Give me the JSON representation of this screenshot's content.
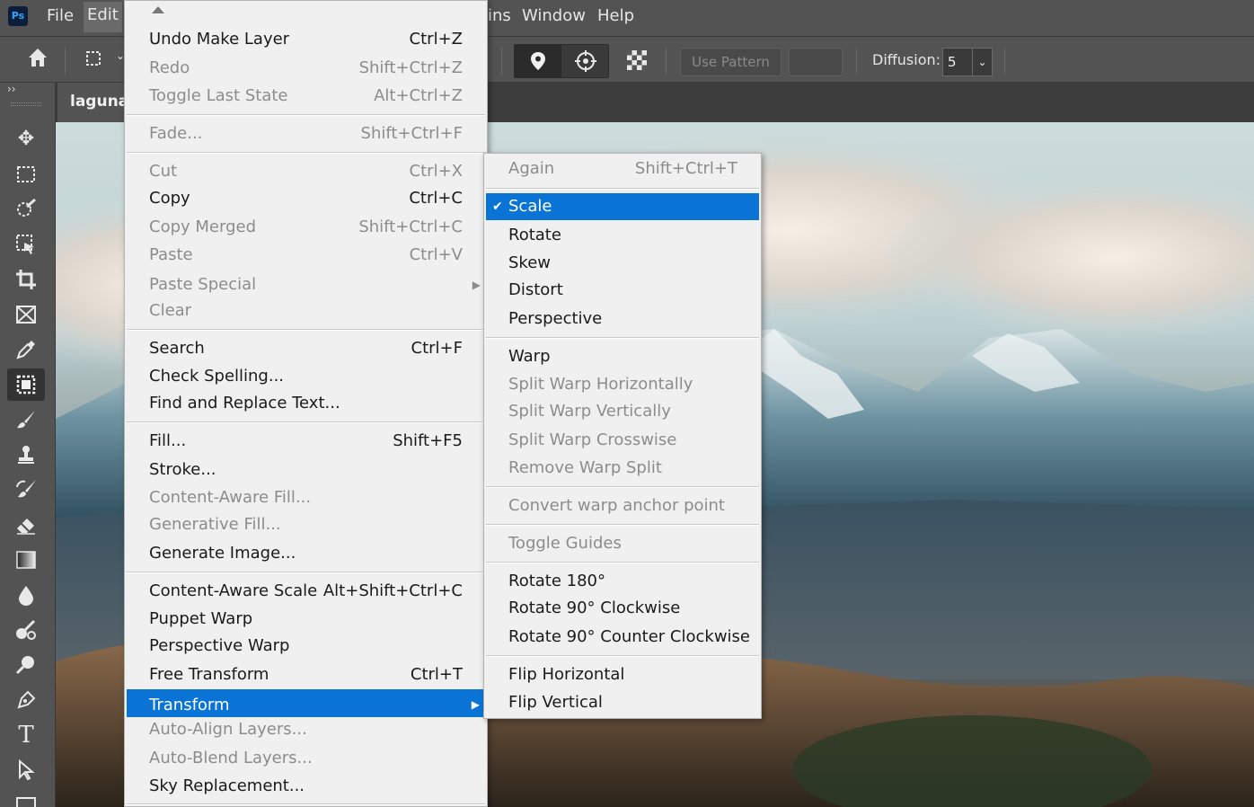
{
  "menubar": {
    "app_icon": "Ps",
    "items": [
      "File",
      "Edit",
      "ins",
      "Window",
      "Help"
    ]
  },
  "options_bar": {
    "icons": [
      "home-icon",
      "selection-transform-icon",
      "pin-icon",
      "crosshair-icon",
      "checker-pattern-icon"
    ],
    "use_pattern_label": "Use Pattern",
    "diffusion_label": "Diffusion:",
    "diffusion_value": "5"
  },
  "document": {
    "tab_title": "laguna-"
  },
  "edit_menu": {
    "items": [
      {
        "label": "Undo Make Layer",
        "shortcut": "Ctrl+Z",
        "disabled": false
      },
      {
        "label": "Redo",
        "shortcut": "Shift+Ctrl+Z",
        "disabled": true
      },
      {
        "label": "Toggle Last State",
        "shortcut": "Alt+Ctrl+Z",
        "disabled": true
      },
      {
        "label": "Fade...",
        "shortcut": "Shift+Ctrl+F",
        "disabled": true
      },
      {
        "label": "Cut",
        "shortcut": "Ctrl+X",
        "disabled": true
      },
      {
        "label": "Copy",
        "shortcut": "Ctrl+C",
        "disabled": false
      },
      {
        "label": "Copy Merged",
        "shortcut": "Shift+Ctrl+C",
        "disabled": true
      },
      {
        "label": "Paste",
        "shortcut": "Ctrl+V",
        "disabled": true
      },
      {
        "label": "Paste Special",
        "shortcut": "",
        "disabled": true
      },
      {
        "label": "Clear",
        "shortcut": "",
        "disabled": true
      },
      {
        "label": "Search",
        "shortcut": "Ctrl+F",
        "disabled": false
      },
      {
        "label": "Check Spelling...",
        "shortcut": "",
        "disabled": false
      },
      {
        "label": "Find and Replace Text...",
        "shortcut": "",
        "disabled": false
      },
      {
        "label": "Fill...",
        "shortcut": "Shift+F5",
        "disabled": false
      },
      {
        "label": "Stroke...",
        "shortcut": "",
        "disabled": false
      },
      {
        "label": "Content-Aware Fill...",
        "shortcut": "",
        "disabled": true
      },
      {
        "label": "Generative Fill...",
        "shortcut": "",
        "disabled": true
      },
      {
        "label": "Generate Image...",
        "shortcut": "",
        "disabled": false
      },
      {
        "label": "Content-Aware Scale",
        "shortcut": "Alt+Shift+Ctrl+C",
        "disabled": false
      },
      {
        "label": "Puppet Warp",
        "shortcut": "",
        "disabled": false
      },
      {
        "label": "Perspective Warp",
        "shortcut": "",
        "disabled": false
      },
      {
        "label": "Free Transform",
        "shortcut": "Ctrl+T",
        "disabled": false
      },
      {
        "label": "Transform",
        "shortcut": "",
        "disabled": false
      },
      {
        "label": "Auto-Align Layers...",
        "shortcut": "",
        "disabled": true
      },
      {
        "label": "Auto-Blend Layers...",
        "shortcut": "",
        "disabled": true
      },
      {
        "label": "Sky Replacement...",
        "shortcut": "",
        "disabled": false
      }
    ]
  },
  "transform_menu": {
    "items": [
      {
        "label": "Again",
        "shortcut": "Shift+Ctrl+T",
        "disabled": true
      },
      {
        "label": "Scale",
        "shortcut": "",
        "disabled": false
      },
      {
        "label": "Rotate",
        "shortcut": "",
        "disabled": false
      },
      {
        "label": "Skew",
        "shortcut": "",
        "disabled": false
      },
      {
        "label": "Distort",
        "shortcut": "",
        "disabled": false
      },
      {
        "label": "Perspective",
        "shortcut": "",
        "disabled": false
      },
      {
        "label": "Warp",
        "shortcut": "",
        "disabled": false
      },
      {
        "label": "Split Warp Horizontally",
        "shortcut": "",
        "disabled": true
      },
      {
        "label": "Split Warp Vertically",
        "shortcut": "",
        "disabled": true
      },
      {
        "label": "Split Warp Crosswise",
        "shortcut": "",
        "disabled": true
      },
      {
        "label": "Remove Warp Split",
        "shortcut": "",
        "disabled": true
      },
      {
        "label": "Convert warp anchor point",
        "shortcut": "",
        "disabled": true
      },
      {
        "label": "Toggle Guides",
        "shortcut": "",
        "disabled": true
      },
      {
        "label": "Rotate 180°",
        "shortcut": "",
        "disabled": false
      },
      {
        "label": "Rotate 90° Clockwise",
        "shortcut": "",
        "disabled": false
      },
      {
        "label": "Rotate 90° Counter Clockwise",
        "shortcut": "",
        "disabled": false
      },
      {
        "label": "Flip Horizontal",
        "shortcut": "",
        "disabled": false
      },
      {
        "label": "Flip Vertical",
        "shortcut": "",
        "disabled": false
      }
    ]
  },
  "colors": {
    "highlight": "#0a74d6",
    "menu_bg": "#f0f0f0",
    "chrome_bg": "#535353"
  }
}
